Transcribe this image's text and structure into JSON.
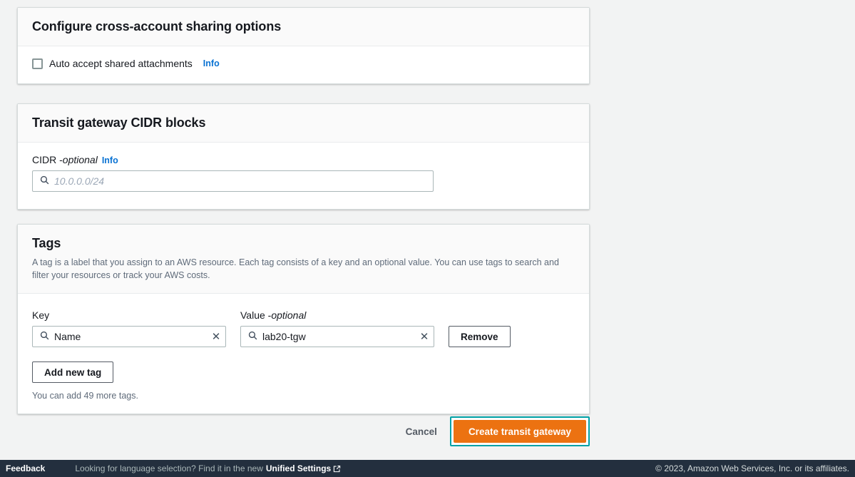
{
  "cross_account": {
    "title": "Configure cross-account sharing options",
    "checkbox_label": "Auto accept shared attachments",
    "info_label": "Info"
  },
  "cidr": {
    "title": "Transit gateway CIDR blocks",
    "field_label": "CIDR - ",
    "field_optional": "optional",
    "info_label": "Info",
    "placeholder": "10.0.0.0/24",
    "value": ""
  },
  "tags": {
    "title": "Tags",
    "description": "A tag is a label that you assign to an AWS resource. Each tag consists of a key and an optional value. You can use tags to search and filter your resources or track your AWS costs.",
    "key_label": "Key",
    "value_label": "Value - ",
    "value_optional": "optional",
    "rows": [
      {
        "key": "Name",
        "value": "lab20-tgw",
        "remove_label": "Remove"
      }
    ],
    "add_label": "Add new tag",
    "note": "You can add 49 more tags.",
    "clear_icon": "✕"
  },
  "actions": {
    "cancel_label": "Cancel",
    "create_label": "Create transit gateway",
    "primary_color": "#ec7211",
    "focus_ring_color": "#00a1a6"
  },
  "footer": {
    "feedback": "Feedback",
    "language_text": "Looking for language selection? Find it in the new",
    "unified_settings": "Unified Settings",
    "copyright": "© 2023, Amazon Web Services, Inc. or its affiliates.",
    "background": "#232f3e"
  }
}
